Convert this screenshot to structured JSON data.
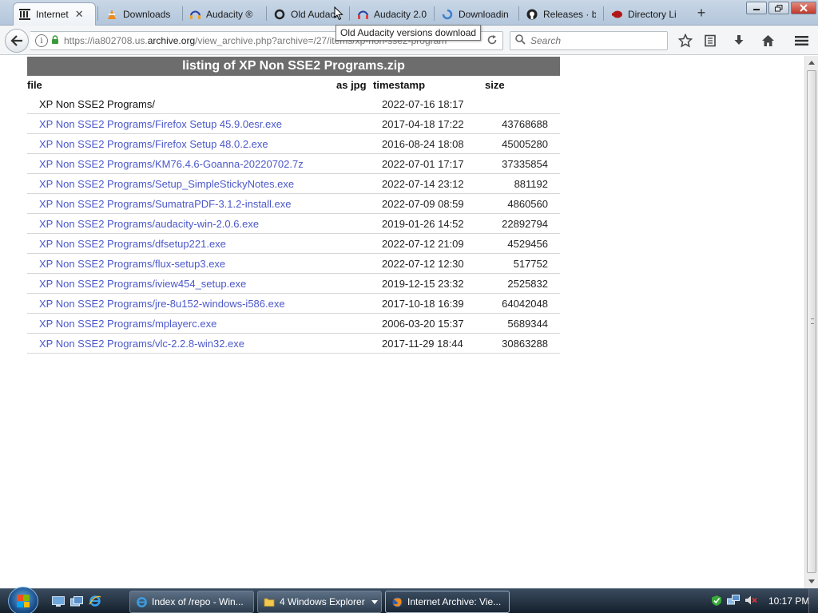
{
  "browser": {
    "tabs": [
      {
        "label": "Internet",
        "icon": "archive-icon"
      },
      {
        "label": "Downloads",
        "icon": "vlc-icon"
      },
      {
        "label": "Audacity ®",
        "icon": "audacity-icon"
      },
      {
        "label": "Old Audaci",
        "icon": "loading-icon"
      },
      {
        "label": "Audacity 2.0",
        "icon": "audacity-icon"
      },
      {
        "label": "Downloadin",
        "icon": "loading-icon"
      },
      {
        "label": "Releases · b",
        "icon": "github-icon"
      },
      {
        "label": "Directory Li",
        "icon": "bird-icon"
      }
    ],
    "new_tab_symbol": "+",
    "tab_close_symbol": "✕",
    "url_prefix": "https://ia802708.us.",
    "url_domain": "archive.org",
    "url_rest": "/view_archive.php?archive=/27/items/xp-non-sse2-program",
    "search_placeholder": "Search",
    "tooltip": "Old Audacity versions download"
  },
  "listing": {
    "title": "listing of XP Non SSE2 Programs.zip",
    "columns": {
      "file": "file",
      "as_jpg": "as jpg",
      "timestamp": "timestamp",
      "size": "size"
    },
    "rows": [
      {
        "name": "XP Non SSE2 Programs/",
        "timestamp": "2022-07-16 18:17",
        "size": "",
        "link": false
      },
      {
        "name": "XP Non SSE2 Programs/Firefox Setup 45.9.0esr.exe",
        "timestamp": "2017-04-18 17:22",
        "size": "43768688",
        "link": true
      },
      {
        "name": "XP Non SSE2 Programs/Firefox Setup 48.0.2.exe",
        "timestamp": "2016-08-24 18:08",
        "size": "45005280",
        "link": true
      },
      {
        "name": "XP Non SSE2 Programs/KM76.4.6-Goanna-20220702.7z",
        "timestamp": "2022-07-01 17:17",
        "size": "37335854",
        "link": true
      },
      {
        "name": "XP Non SSE2 Programs/Setup_SimpleStickyNotes.exe",
        "timestamp": "2022-07-14 23:12",
        "size": "881192",
        "link": true
      },
      {
        "name": "XP Non SSE2 Programs/SumatraPDF-3.1.2-install.exe",
        "timestamp": "2022-07-09 08:59",
        "size": "4860560",
        "link": true
      },
      {
        "name": "XP Non SSE2 Programs/audacity-win-2.0.6.exe",
        "timestamp": "2019-01-26 14:52",
        "size": "22892794",
        "link": true
      },
      {
        "name": "XP Non SSE2 Programs/dfsetup221.exe",
        "timestamp": "2022-07-12 21:09",
        "size": "4529456",
        "link": true
      },
      {
        "name": "XP Non SSE2 Programs/flux-setup3.exe",
        "timestamp": "2022-07-12 12:30",
        "size": "517752",
        "link": true
      },
      {
        "name": "XP Non SSE2 Programs/iview454_setup.exe",
        "timestamp": "2019-12-15 23:32",
        "size": "2525832",
        "link": true
      },
      {
        "name": "XP Non SSE2 Programs/jre-8u152-windows-i586.exe",
        "timestamp": "2017-10-18 16:39",
        "size": "64042048",
        "link": true
      },
      {
        "name": "XP Non SSE2 Programs/mplayerc.exe",
        "timestamp": "2006-03-20 15:37",
        "size": "5689344",
        "link": true
      },
      {
        "name": "XP Non SSE2 Programs/vlc-2.2.8-win32.exe",
        "timestamp": "2017-11-29 18:44",
        "size": "30863288",
        "link": true
      }
    ]
  },
  "taskbar": {
    "buttons": [
      {
        "label": "Index of /repo - Win...",
        "icon": "ie-icon"
      },
      {
        "label": "4 Windows Explorer",
        "icon": "folder-icon"
      },
      {
        "label": "Internet Archive: Vie...",
        "icon": "firefox-icon"
      }
    ],
    "clock": "10:17 PM"
  },
  "colors": {
    "link": "#4b58c9",
    "title_bar": "#6d6d6d"
  }
}
